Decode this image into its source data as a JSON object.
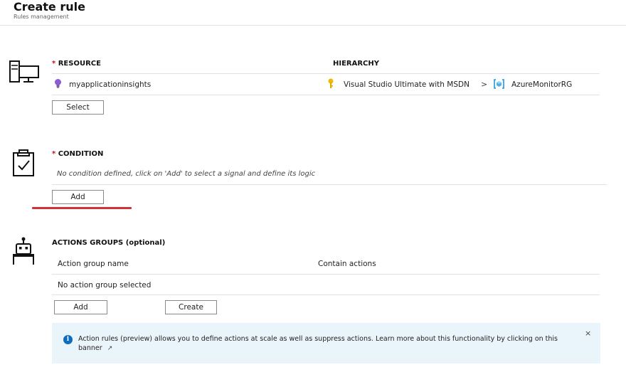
{
  "header": {
    "title": "Create rule",
    "subtitle": "Rules management"
  },
  "resource": {
    "required_mark": "*",
    "label": "RESOURCE",
    "hierarchy_label": "HIERARCHY",
    "resource_name": "myapplicationinsights",
    "subscription": "Visual Studio Ultimate with MSDN",
    "separator": ">",
    "resource_group": "AzureMonitorRG",
    "select_button": "Select"
  },
  "condition": {
    "required_mark": "*",
    "label": "CONDITION",
    "empty_text": "No condition defined, click on 'Add' to select a signal and define its logic",
    "add_button": "Add"
  },
  "actions": {
    "label": "ACTIONS GROUPS (optional)",
    "col_name": "Action group name",
    "col_actions": "Contain actions",
    "empty_text": "No action group selected",
    "add_button": "Add",
    "create_button": "Create"
  },
  "banner": {
    "text": "Action rules (preview) allows you to define actions at scale as well as suppress actions. Learn more about this functionality by clicking on this banner",
    "info_glyph": "i",
    "close_glyph": "×",
    "external_glyph": "↗"
  },
  "colors": {
    "accent": "#0f6cbd",
    "required": "#c50f1f",
    "underline": "#d13438",
    "banner_bg": "#eaf4fb"
  }
}
